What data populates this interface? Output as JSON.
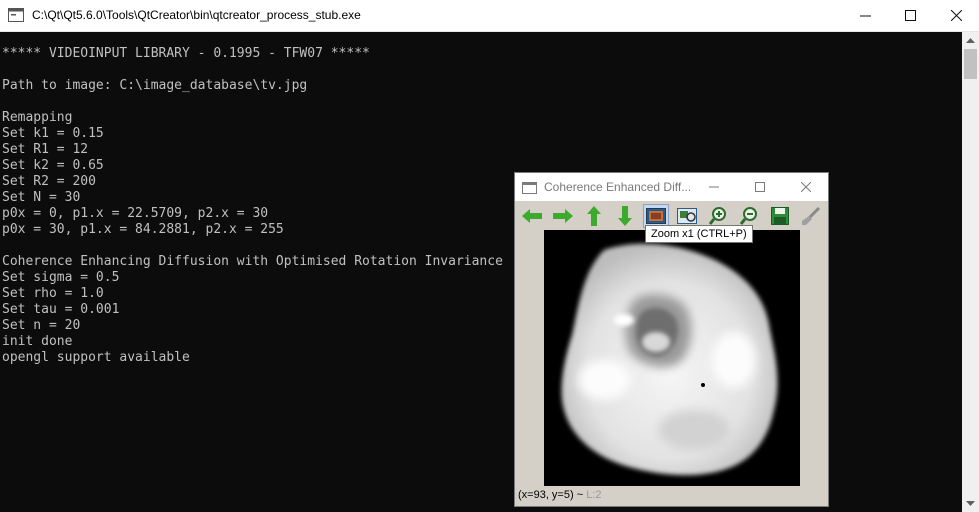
{
  "console": {
    "title": "C:\\Qt\\Qt5.6.0\\Tools\\QtCreator\\bin\\qtcreator_process_stub.exe",
    "lines": [
      "***** VIDEOINPUT LIBRARY - 0.1995 - TFW07 *****",
      "",
      "Path to image: C:\\image_database\\tv.jpg",
      "",
      "Remapping",
      "Set k1 = 0.15",
      "Set R1 = 12",
      "Set k2 = 0.65",
      "Set R2 = 200",
      "Set N = 30",
      "p0x = 0, p1.x = 22.5709, p2.x = 30",
      "p0x = 30, p1.x = 84.2881, p2.x = 255",
      "",
      "Coherence Enhancing Diffusion with Optimised Rotation Invariance",
      "Set sigma = 0.5",
      "Set rho = 1.0",
      "Set tau = 0.001",
      "Set n = 20",
      "init done",
      "opengl support available"
    ]
  },
  "viewer": {
    "title": "Coherence Enhanced Diff...",
    "tooltip": "Zoom x1 (CTRL+P)",
    "status": {
      "coords": "(x=93, y=5) ~",
      "channel": "L:2"
    }
  }
}
